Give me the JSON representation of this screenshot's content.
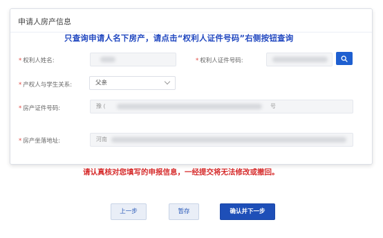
{
  "section": {
    "title": "申请人房产信息",
    "notice": "只查询申请人名下房产，请点击“权利人证件号码”右侧按钮查询"
  },
  "form": {
    "owner_name_label": "权利人姓名:",
    "owner_id_label": "权利人证件号码:",
    "relation_label": "产权人与学生关系:",
    "relation_value": "父亲",
    "cert_no_label": "房产证件号码:",
    "cert_no_value_prefix": "豫 (",
    "cert_no_value_suffix": "号",
    "address_label": "房产坐落地址:",
    "address_value_prefix": "河南"
  },
  "warning": "请认真核对您填写的申报信息，一经提交将无法修改或撤回。",
  "actions": {
    "prev_label": "上一步",
    "save_label": "暂存",
    "next_label": "确认并下一步"
  },
  "colors": {
    "accent": "#1e4fb8",
    "notice": "#2148c0",
    "warning": "#d62c2c",
    "required": "#e0463f"
  },
  "icons": {
    "search": "search-icon",
    "dropdown": "chevron-down-icon"
  }
}
